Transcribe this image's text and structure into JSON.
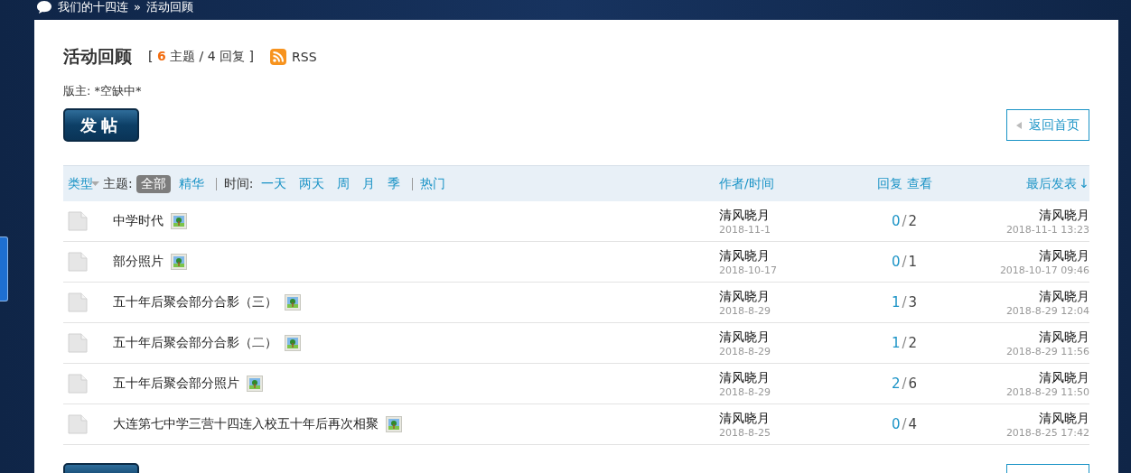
{
  "breadcrumb": {
    "items": [
      "我们的十四连",
      "活动回顾"
    ],
    "separator": "»"
  },
  "forum": {
    "title": "活动回顾",
    "stats": "[ **6** 主题 / 4 回复 ]",
    "rss": "RSS",
    "moderator": "版主: *空缺中*"
  },
  "toolbar": {
    "post_button": "发帖",
    "back_link": "返回首页"
  },
  "filter_bar": {
    "type_label": "类型",
    "topic_label": "主题:",
    "topic_filters": [
      {
        "label": "全部",
        "selected": true
      },
      {
        "label": "精华",
        "selected": false
      }
    ],
    "time_label": "时间:",
    "time_filters": [
      {
        "label": "一天",
        "selected": false
      },
      {
        "label": "两天",
        "selected": false
      },
      {
        "label": "周",
        "selected": false
      },
      {
        "label": "月",
        "selected": false
      },
      {
        "label": "季",
        "selected": false
      }
    ],
    "hot": "热门",
    "author_header": "作者/时间",
    "replies_header": "回复",
    "views_header": "查看",
    "last_post_header": "最后发表",
    "sort_arrow": "↓"
  },
  "threads": [
    {
      "title": "中学时代",
      "has_image": true,
      "author": "清风晓月",
      "date": "2018-11-1",
      "replies": "0",
      "count_separator": "/",
      "views": "2",
      "last_author": "清风晓月",
      "last_time": "2018-11-1 13:23"
    },
    {
      "title": "部分照片",
      "has_image": true,
      "author": "清风晓月",
      "date": "2018-10-17",
      "replies": "0",
      "count_separator": "/",
      "views": "1",
      "last_author": "清风晓月",
      "last_time": "2018-10-17 09:46"
    },
    {
      "title": "五十年后聚会部分合影（三）",
      "has_image": true,
      "author": "清风晓月",
      "date": "2018-8-29",
      "replies": "1",
      "count_separator": "/",
      "views": "3",
      "last_author": "清风晓月",
      "last_time": "2018-8-29 12:04"
    },
    {
      "title": "五十年后聚会部分合影（二）",
      "has_image": true,
      "author": "清风晓月",
      "date": "2018-8-29",
      "replies": "1",
      "count_separator": "/",
      "views": "2",
      "last_author": "清风晓月",
      "last_time": "2018-8-29 11:56"
    },
    {
      "title": "五十年后聚会部分照片",
      "has_image": true,
      "author": "清风晓月",
      "date": "2018-8-29",
      "replies": "2",
      "count_separator": "/",
      "views": "6",
      "last_author": "清风晓月",
      "last_time": "2018-8-29 11:50"
    },
    {
      "title": "大连第七中学三营十四连入校五十年后再次相聚",
      "has_image": true,
      "author": "清风晓月",
      "date": "2018-8-25",
      "replies": "0",
      "count_separator": "/",
      "views": "4",
      "last_author": "清风晓月",
      "last_time": "2018-8-25 17:42"
    }
  ]
}
